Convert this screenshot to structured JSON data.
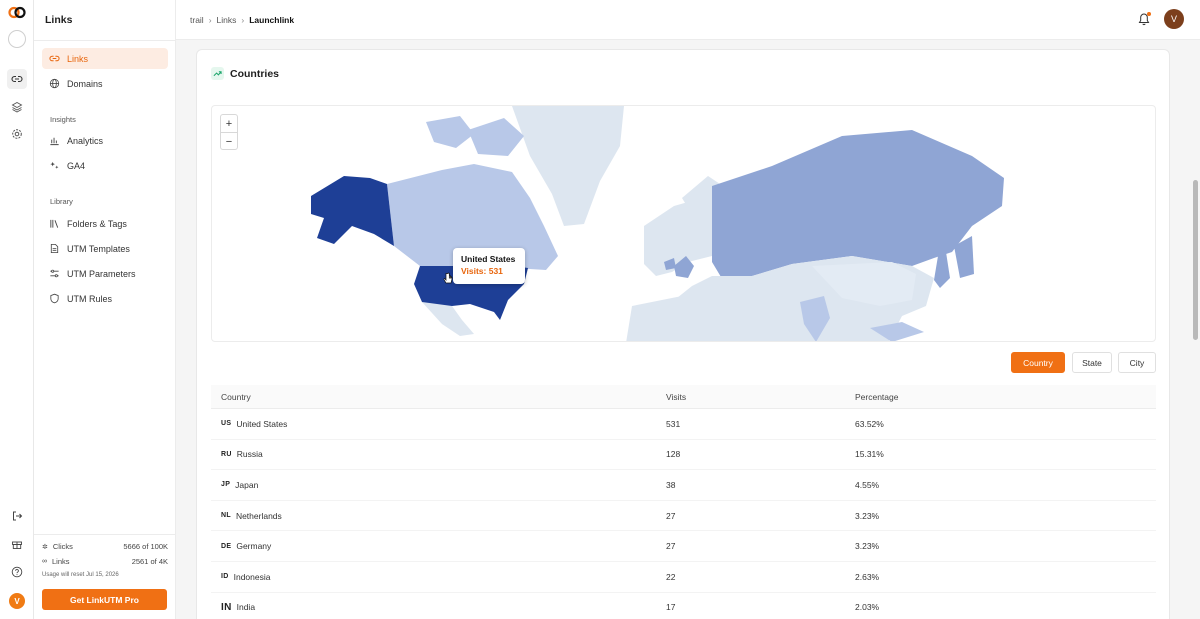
{
  "sidebar": {
    "title": "Links",
    "nav": [
      {
        "label": "Links",
        "icon": "link-icon",
        "active": true
      },
      {
        "label": "Domains",
        "icon": "globe-icon"
      }
    ],
    "insights_label": "Insights",
    "insights": [
      {
        "label": "Analytics",
        "icon": "bar-chart-icon"
      },
      {
        "label": "GA4",
        "icon": "sparkle-icon"
      }
    ],
    "library_label": "Library",
    "library": [
      {
        "label": "Folders & Tags",
        "icon": "library-icon"
      },
      {
        "label": "UTM Templates",
        "icon": "document-icon"
      },
      {
        "label": "UTM Parameters",
        "icon": "sliders-icon"
      },
      {
        "label": "UTM Rules",
        "icon": "shield-icon"
      }
    ],
    "usage": [
      {
        "label": "Clicks",
        "value": "5666 of 100K"
      },
      {
        "label": "Links",
        "value": "2561 of 4K"
      }
    ],
    "reset_note": "Usage will reset Jul 15, 2026",
    "pro_button": "Get LinkUTM Pro"
  },
  "rail": {
    "avatar": "V"
  },
  "header": {
    "breadcrumb": [
      "trail",
      "Links",
      "Launchlink"
    ],
    "avatar": "V"
  },
  "card": {
    "title": "Countries",
    "tooltip": {
      "name": "United States",
      "visits": "Visits: 531"
    },
    "zoom_in": "+",
    "zoom_out": "−",
    "segments": [
      "Country",
      "State",
      "City"
    ],
    "columns": [
      "Country",
      "Visits",
      "Percentage"
    ],
    "rows": [
      {
        "code": "US",
        "country": "United States",
        "visits": "531",
        "pct": "63.52%"
      },
      {
        "code": "RU",
        "country": "Russia",
        "visits": "128",
        "pct": "15.31%"
      },
      {
        "code": "JP",
        "country": "Japan",
        "visits": "38",
        "pct": "4.55%"
      },
      {
        "code": "NL",
        "country": "Netherlands",
        "visits": "27",
        "pct": "3.23%"
      },
      {
        "code": "DE",
        "country": "Germany",
        "visits": "27",
        "pct": "3.23%"
      },
      {
        "code": "ID",
        "country": "Indonesia",
        "visits": "22",
        "pct": "2.63%"
      },
      {
        "code": "IN",
        "country": "India",
        "visits": "17",
        "pct": "2.03%"
      }
    ]
  },
  "colors": {
    "accent": "#f07014",
    "map_high": "#1e3f96",
    "map_mid": "#8fa5d4",
    "map_low": "#b8c8e8",
    "map_none": "#dde6f0"
  }
}
